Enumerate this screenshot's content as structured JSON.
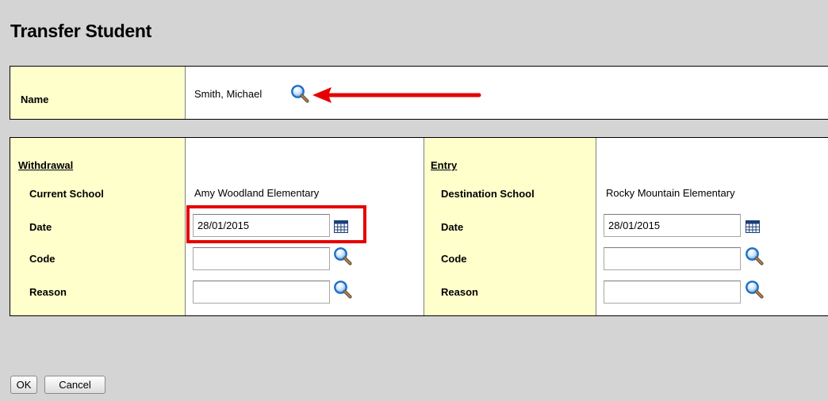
{
  "title": "Transfer Student",
  "student": {
    "label": "Name",
    "value": "Smith, Michael",
    "lookup_icon": "magnifier-icon"
  },
  "withdrawal": {
    "heading": "Withdrawal",
    "current_school_label": "Current School",
    "current_school_value": "Amy Woodland Elementary",
    "date_label": "Date",
    "date_value": "28/01/2015",
    "code_label": "Code",
    "code_value": "",
    "reason_label": "Reason",
    "reason_value": ""
  },
  "entry": {
    "heading": "Entry",
    "destination_school_label": "Destination School",
    "destination_school_value": "Rocky Mountain Elementary",
    "date_label": "Date",
    "date_value": "28/01/2015",
    "code_label": "Code",
    "code_value": "",
    "reason_label": "Reason",
    "reason_value": ""
  },
  "buttons": {
    "ok": "OK",
    "cancel": "Cancel"
  },
  "colors": {
    "label_bg": "#ffffcc",
    "page_bg": "#d4d4d4",
    "annotation_red": "#e60000"
  }
}
